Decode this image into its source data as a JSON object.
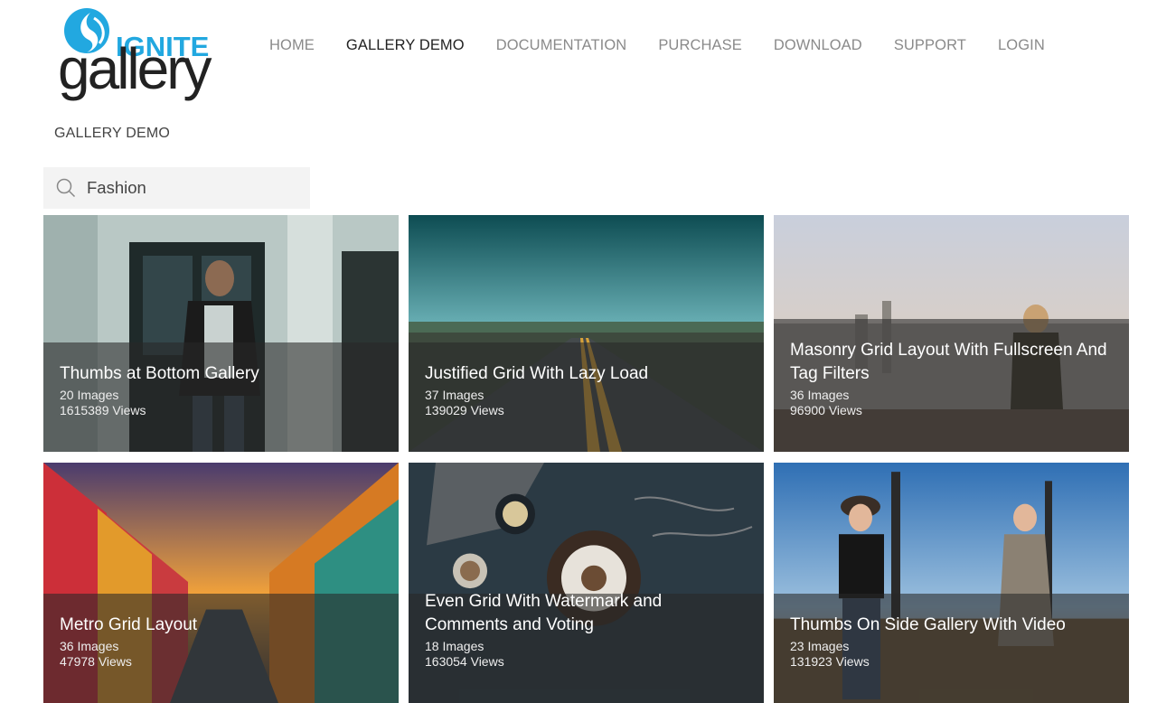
{
  "brand": {
    "logo_top": "IGNITE",
    "logo_bottom": "gallery",
    "logo_color": "#22a8e0"
  },
  "nav": {
    "items": [
      {
        "label": "HOME"
      },
      {
        "label": "GALLERY DEMO"
      },
      {
        "label": "DOCUMENTATION"
      },
      {
        "label": "PURCHASE"
      },
      {
        "label": "DOWNLOAD"
      },
      {
        "label": "SUPPORT"
      },
      {
        "label": "LOGIN"
      }
    ],
    "active": "GALLERY DEMO"
  },
  "breadcrumb": "GALLERY DEMO",
  "search": {
    "value": "Fashion",
    "icon": "search-icon"
  },
  "galleries": [
    {
      "title": "Thumbs at Bottom Gallery",
      "images": "20 Images",
      "views": "1615389 Views"
    },
    {
      "title": "Justified Grid With Lazy Load",
      "images": "37 Images",
      "views": "139029 Views"
    },
    {
      "title": "Masonry Grid Layout With Fullscreen And Tag Filters",
      "images": "36 Images",
      "views": "96900 Views"
    },
    {
      "title": "Metro Grid Layout",
      "images": "36 Images",
      "views": "47978 Views"
    },
    {
      "title": "Even Grid With Watermark and Comments and Voting",
      "images": "18 Images",
      "views": "163054 Views"
    },
    {
      "title": "Thumbs On Side Gallery With Video",
      "images": "23 Images",
      "views": "131923 Views"
    }
  ]
}
